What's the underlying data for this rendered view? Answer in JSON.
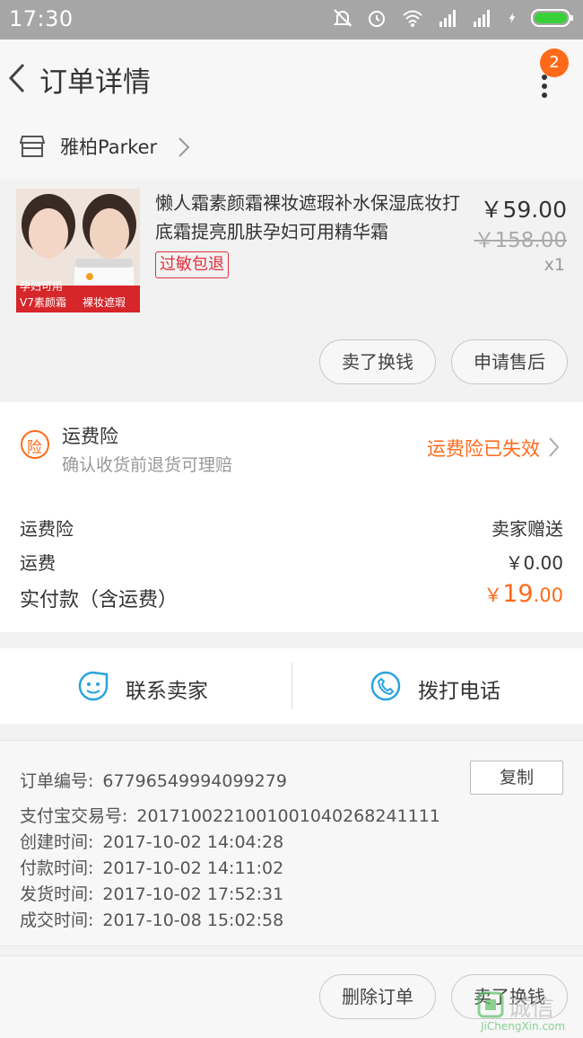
{
  "status_bar": {
    "time": "17:30"
  },
  "header": {
    "title": "订单详情",
    "badge_count": "2"
  },
  "shop": {
    "name": "雅柏Parker"
  },
  "product": {
    "title": "懒人霜素颜霜裸妆遮瑕补水保湿底妆打底霜提亮肌肤孕妇可用精华霜",
    "tag": "过敏包退",
    "price": "￥59.00",
    "original_price": "￥158.00",
    "quantity": "x1",
    "image_caption_line1": "孕妇可用",
    "image_caption_line2": "V7素颜霜",
    "image_caption_right": "裸妆遮瑕",
    "buttons": {
      "resell": "卖了换钱",
      "after_sale": "申请售后"
    }
  },
  "insurance": {
    "title": "运费险",
    "subtitle": "确认收货前退货可理赔",
    "status": "运费险已失效",
    "icon_char": "险"
  },
  "cost": {
    "rows": [
      {
        "label": "运费险",
        "value": "卖家赠送"
      },
      {
        "label": "运费",
        "value": "￥0.00"
      }
    ],
    "paid_label": "实付款（含运费）",
    "paid_currency": "￥",
    "paid_integer": "19",
    "paid_decimal": ".00"
  },
  "contact": {
    "seller": "联系卖家",
    "phone": "拨打电话"
  },
  "order_info": {
    "copy_label": "复制",
    "lines": [
      {
        "label": "订单编号:",
        "value": "67796549994099279"
      },
      {
        "label": "支付宝交易号:",
        "value": "2017100221001001040268241111"
      },
      {
        "label": "创建时间:",
        "value": "2017-10-02 14:04:28"
      },
      {
        "label": "付款时间:",
        "value": "2017-10-02 14:11:02"
      },
      {
        "label": "发货时间:",
        "value": "2017-10-02 17:52:31"
      },
      {
        "label": "成交时间:",
        "value": "2017-10-08 15:02:58"
      }
    ]
  },
  "bottom_bar": {
    "delete_order": "删除订单",
    "resell": "卖了换钱"
  },
  "watermark": {
    "text": "诚信",
    "url": "JiChengXin.com"
  },
  "colors": {
    "accent": "#ff6a1a",
    "tag_red": "#e0313b",
    "contact_blue": "#2aa3e0"
  }
}
